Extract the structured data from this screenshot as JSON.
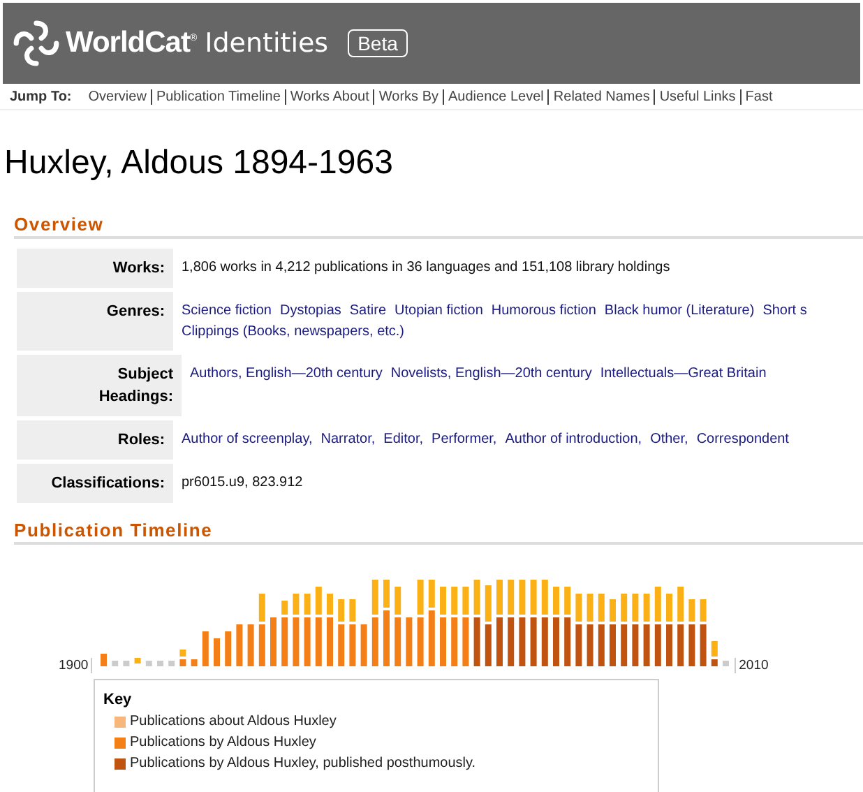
{
  "header": {
    "logo_text": "WorldCat",
    "logo_mark": "®",
    "product": "Identities",
    "badge": "Beta"
  },
  "jump_to": {
    "label": "Jump To:",
    "links": [
      "Overview",
      "Publication Timeline",
      "Works About",
      "Works By",
      "Audience Level",
      "Related Names",
      "Useful Links",
      "Fast"
    ]
  },
  "page_title": "Huxley, Aldous 1894-1963",
  "overview": {
    "heading": "Overview",
    "rows": [
      {
        "label": "Works:",
        "kind": "text",
        "lines": [
          [
            "1,806 works in 4,212 publications in 36 languages and 151,108 library holdings"
          ]
        ]
      },
      {
        "label": "Genres:",
        "kind": "links",
        "lines": [
          [
            "Science fiction",
            "Dystopias",
            "Satire",
            "Utopian fiction",
            "Humorous fiction",
            "Black humor (Literature)",
            "Short s"
          ],
          [
            "Clippings (Books, newspapers, etc.)"
          ]
        ]
      },
      {
        "label": "Subject Headings:",
        "kind": "links",
        "lines": [
          [
            "Authors, English—20th century",
            "Novelists, English—20th century",
            "Intellectuals—Great Britain"
          ]
        ]
      },
      {
        "label": "Roles:",
        "kind": "links",
        "lines": [
          [
            "Author of screenplay,",
            "Narrator,",
            "Editor,",
            "Performer,",
            "Author of introduction,",
            "Other,",
            "Correspondent"
          ]
        ]
      },
      {
        "label": "Classifications:",
        "kind": "text",
        "lines": [
          [
            "pr6015.u9, 823.912"
          ]
        ]
      }
    ]
  },
  "timeline": {
    "heading": "Publication Timeline",
    "start_label": "1900",
    "end_label": "2010",
    "key": {
      "title": "Key",
      "items": [
        {
          "label": "Publications about Aldous Huxley",
          "color": "#f7b77a"
        },
        {
          "label": "Publications by Aldous Huxley",
          "color": "#f57f17"
        },
        {
          "label": "Publications by Aldous Huxley, published posthumously.",
          "color": "#c0530f"
        }
      ]
    }
  }
}
